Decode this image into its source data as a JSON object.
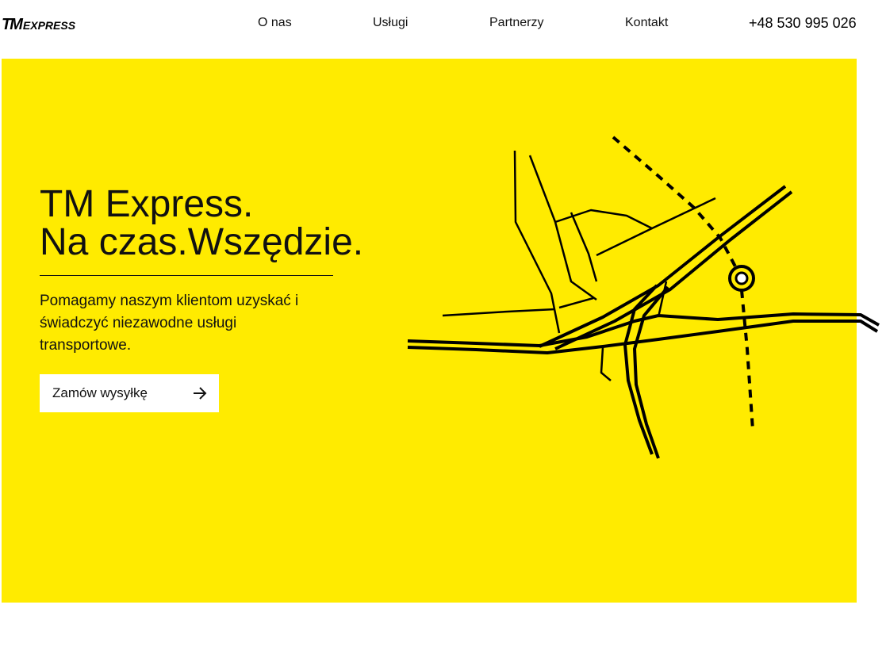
{
  "brand": {
    "logo_mark": "TM",
    "logo_word": "EXPRESS"
  },
  "nav": {
    "items": [
      {
        "label": "O nas"
      },
      {
        "label": "Usługi"
      },
      {
        "label": "Partnerzy"
      },
      {
        "label": "Kontakt"
      }
    ],
    "phone": "+48 530 995 026"
  },
  "hero": {
    "title_line1": "TM Express.",
    "title_line2": "Na czas.Wszędzie.",
    "description": "Pomagamy naszym klientom uzyskać i świadczyć niezawodne usługi transportowe.",
    "cta_label": "Zamów wysyłkę",
    "cta_icon": "arrow-right-icon",
    "illustration": "route-map-illustration"
  },
  "colors": {
    "accent": "#ffeb00",
    "text": "#111111",
    "button_bg": "#ffffff"
  }
}
